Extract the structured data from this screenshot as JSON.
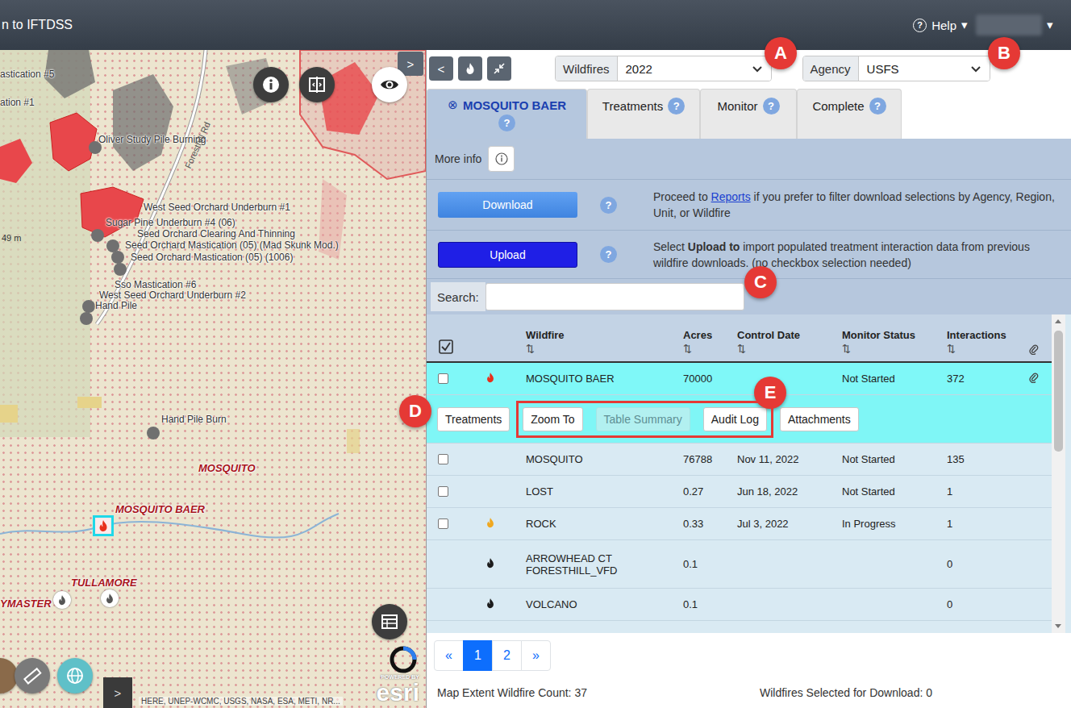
{
  "header": {
    "title": "n to IFTDSS",
    "help_icon": "?",
    "help": "Help",
    "help_caret": "▾",
    "user_caret": "▾"
  },
  "map": {
    "labels": [
      {
        "text": "astication #5",
        "kind": "treatment"
      },
      {
        "text": "ation #1",
        "kind": "treatment"
      },
      {
        "text": "Oliver Study Pile Burning",
        "kind": "treatment"
      },
      {
        "text": "West Seed Orchard Underburn #1",
        "kind": "treatment"
      },
      {
        "text": "Sugar Pine Underburn #4 (06)",
        "kind": "treatment"
      },
      {
        "text": "Seed Orchard Clearing And Thinning",
        "kind": "treatment"
      },
      {
        "text": "Seed Orchard Mastication (05) (Mad Skunk Mod.)",
        "kind": "treatment"
      },
      {
        "text": "Seed Orchard Mastication (05) (1006)",
        "kind": "treatment"
      },
      {
        "text": "Sso Mastication #6",
        "kind": "treatment"
      },
      {
        "text": "West Seed Orchard Underburn #2",
        "kind": "treatment"
      },
      {
        "text": "Hand Pile",
        "kind": "treatment"
      },
      {
        "text": "Hand Pile Burn",
        "kind": "treatment"
      },
      {
        "text": "MOSQUITO",
        "kind": "fire"
      },
      {
        "text": "MOSQUITO BAER",
        "kind": "fire"
      },
      {
        "text": "TULLAMORE",
        "kind": "fire"
      },
      {
        "text": "YMASTER",
        "kind": "fire"
      }
    ],
    "road": "Foresthill Rd",
    "scale": "49 m",
    "expand": ">",
    "tools_expand": ">",
    "attribution": "HERE, UNEP-WCMC, USGS, NASA, ESA, METI, NR...",
    "esri_powered": "POWERED BY",
    "esri_brand": "esri"
  },
  "toolbar": {
    "back": "<",
    "wildfires_label": "Wildfires",
    "wildfires_value": "2022",
    "agency_label": "Agency",
    "agency_value": "USFS"
  },
  "tabs": [
    {
      "label": "MOSQUITO BAER",
      "close": "⊗",
      "help": "?",
      "selected": true
    },
    {
      "label": "Treatments",
      "help": "?",
      "selected": false
    },
    {
      "label": "Monitor",
      "help": "?",
      "selected": false
    },
    {
      "label": "Complete",
      "help": "?",
      "selected": false
    }
  ],
  "more_info": {
    "label": "More info"
  },
  "actions": [
    {
      "button": "Download",
      "kind": "download",
      "help": "?",
      "description": [
        {
          "text": "Proceed to ",
          "kind": "plain"
        },
        {
          "text": "Reports",
          "kind": "link"
        },
        {
          "text": " if you prefer to filter download selections by Agency, Region, Unit, or Wildfire",
          "kind": "plain"
        }
      ]
    },
    {
      "button": "Upload",
      "kind": "upload",
      "help": "?",
      "description": [
        {
          "text": "Select ",
          "kind": "plain"
        },
        {
          "text": "Upload to",
          "kind": "bold"
        },
        {
          "text": " import populated treatment interaction data from previous wildfire downloads. (no checkbox selection needed)",
          "kind": "plain"
        }
      ]
    }
  ],
  "search": {
    "label": "Search:",
    "value": ""
  },
  "table": {
    "columns": [
      {
        "label": "Wildfire",
        "sort": "⇅"
      },
      {
        "label": "Acres",
        "sort": "⇅"
      },
      {
        "label": "Control Date",
        "sort": "⇅"
      },
      {
        "label": "Monitor Status",
        "sort": "⇅"
      },
      {
        "label": "Interactions",
        "sort": "⇅"
      }
    ],
    "rows": [
      {
        "checkbox": true,
        "checked": false,
        "fire_color": "#e8301c",
        "cells": [
          "MOSQUITO BAER",
          "70000",
          "",
          "Not Started",
          "372"
        ],
        "attachment": true,
        "selected": true,
        "expanded": true
      },
      {
        "checkbox": true,
        "checked": false,
        "fire_color": null,
        "cells": [
          "MOSQUITO",
          "76788",
          "Nov 11, 2022",
          "Not Started",
          "135"
        ],
        "attachment": false,
        "selected": false,
        "expanded": false
      },
      {
        "checkbox": true,
        "checked": false,
        "fire_color": null,
        "cells": [
          "LOST",
          "0.27",
          "Jun 18, 2022",
          "Not Started",
          "1"
        ],
        "attachment": false,
        "selected": false,
        "expanded": false
      },
      {
        "checkbox": true,
        "checked": false,
        "fire_color": "#f0a820",
        "cells": [
          "ROCK",
          "0.33",
          "Jul 3, 2022",
          "In Progress",
          "1"
        ],
        "attachment": false,
        "selected": false,
        "expanded": false
      },
      {
        "checkbox": false,
        "fire_color": "#1c1c1c",
        "cells": [
          "ARROWHEAD CT FORESTHILL_VFD",
          "0.1",
          "",
          "",
          "0"
        ],
        "attachment": false,
        "selected": false,
        "expanded": false
      },
      {
        "checkbox": false,
        "fire_color": "#1c1c1c",
        "cells": [
          "VOLCANO",
          "0.1",
          "",
          "",
          "0"
        ],
        "attachment": false,
        "selected": false,
        "expanded": false
      }
    ],
    "row_actions": [
      {
        "label": "Treatments",
        "disabled": false
      },
      {
        "label": "Zoom To",
        "disabled": false
      },
      {
        "label": "Table Summary",
        "disabled": true
      },
      {
        "label": "Audit Log",
        "disabled": false
      },
      {
        "label": "Attachments",
        "disabled": false
      }
    ]
  },
  "pagination": {
    "prev": "«",
    "pages": [
      {
        "label": "1",
        "selected": true
      },
      {
        "label": "2",
        "selected": false
      }
    ],
    "next": "»"
  },
  "footer": {
    "map_count": "Map Extent Wildfire Count: 37",
    "selected_count": "Wildfires Selected for Download: 0"
  },
  "callouts": [
    {
      "letter": "A"
    },
    {
      "letter": "B"
    },
    {
      "letter": "C"
    },
    {
      "letter": "D"
    },
    {
      "letter": "E"
    }
  ]
}
